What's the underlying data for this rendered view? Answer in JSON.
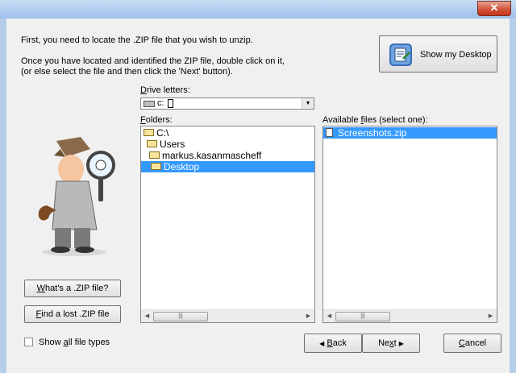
{
  "window": {
    "close_icon": "close-icon"
  },
  "intro": {
    "line1": "First, you need to locate the .ZIP file that you wish to unzip.",
    "line2": "Once you have located and identified the ZIP file, double click on it,",
    "line3": "(or else select the file and then click the 'Next' button)."
  },
  "desktop_button": {
    "label": "Show my Desktop"
  },
  "drive": {
    "label_u": "D",
    "label_rest": "rive letters:",
    "value": "c:"
  },
  "folders": {
    "label_u": "F",
    "label_rest": "olders:",
    "items": [
      "C:\\",
      "Users",
      "markus.kasanmascheff",
      "Desktop"
    ]
  },
  "files": {
    "label_pre": "Available ",
    "label_u": "f",
    "label_rest": "iles (select one):",
    "items": [
      "Screenshots.zip"
    ]
  },
  "left_buttons": {
    "zip_info_u": "W",
    "zip_info_rest": "hat's a .ZIP file?",
    "find_u": "F",
    "find_rest": "ind a lost .ZIP file"
  },
  "show_all": {
    "pre": "Show ",
    "u": "a",
    "rest": "ll file types"
  },
  "nav": {
    "back_u": "B",
    "back_rest": "ack",
    "next_pre": "Ne",
    "next_u": "x",
    "next_rest": "t",
    "cancel_u": "C",
    "cancel_rest": "ancel"
  }
}
